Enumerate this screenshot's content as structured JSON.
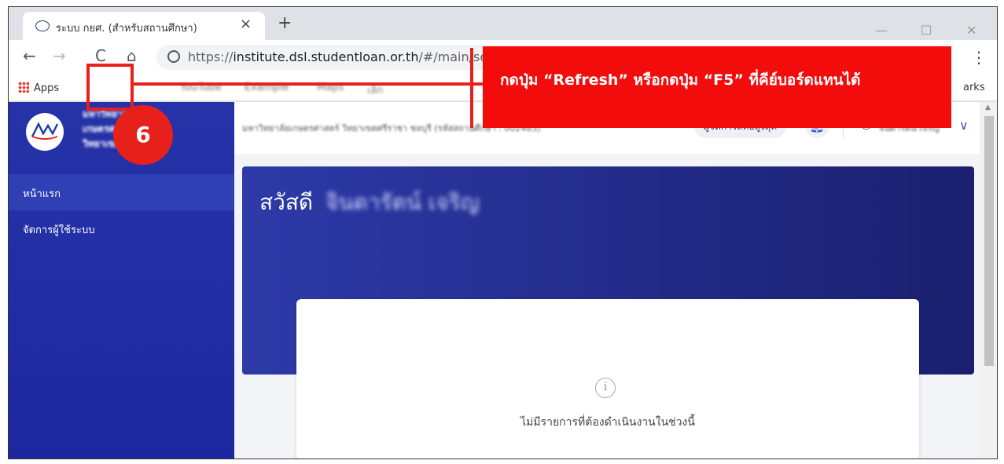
{
  "browser": {
    "tab_title": "ระบบ กยศ. (สำหรับสถานศึกษา)",
    "tab_close": "×",
    "new_tab": "+",
    "url_proto": "https://",
    "url_host": "institute.dsl.studentloan.or.th",
    "url_path": "/#/main/se",
    "back": "←",
    "forward": "→",
    "reload": "C",
    "home": "⌂",
    "menu": "⋮",
    "minimize": "—",
    "maximize": "☐",
    "close_window": "✕"
  },
  "bookmarks": {
    "apps": "Apps",
    "items": [
      "YouTube",
      "Example",
      "Maps",
      "เล็ก"
    ],
    "other": "arks"
  },
  "app": {
    "university_name_lines": [
      "มหาวิทยาลัย",
      "เกษตรศาสตร์",
      "วิทยาเขตศรีราชา"
    ],
    "nav": [
      {
        "label": "หน้าแรก",
        "active": true
      },
      {
        "label": "จัดการผู้ใช้ระบบ",
        "active": false
      }
    ],
    "institution_line": "มหาวิทยาลัยเกษตรศาสตร์ วิทยาเขตศรีราชา ชลบุรี (รหัสสถานศึกษา : 002483)",
    "role": "ผู้จัดการสิทธิ์สูงสุด",
    "user_name": "จินดารัตน์ เจริญ",
    "greeting": "สวัสดี",
    "greeting_name": "จินดารัตน์ เจริญ",
    "empty_message": "ไม่มีรายการที่ต้องดำเนินงานในช่วงนี้",
    "info_symbol": "i"
  },
  "annotation": {
    "step_number": "6",
    "callout_text": "กดปุ่ม “Refresh” หรือกดปุ่ม “F5” ที่คีย์บอร์ดแทนได้"
  },
  "colors": {
    "annotation_red": "#e8201c",
    "sidebar_blue": "#2633a8",
    "banner_dark": "#1a1f6e"
  }
}
